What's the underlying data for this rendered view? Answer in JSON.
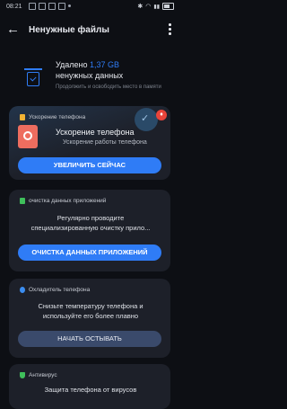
{
  "status": {
    "time": "08:21"
  },
  "appbar": {
    "back_glyph": "←",
    "title": "Ненужные файлы"
  },
  "summary": {
    "prefix": "Удалено",
    "amount": "1,37 GB",
    "line2": "ненужных данных",
    "hint": "Продолжить и освободить место в памяти"
  },
  "cards": {
    "boost": {
      "header": "Ускорение телефона",
      "title": "Ускорение телефона",
      "subtitle": "Ускорение работы телефона",
      "button": "УВЕЛИЧИТЬ СЕЙЧАС"
    },
    "apps": {
      "header": "очистка данных приложений",
      "text": "Регулярно проводите специализированную очистку прило...",
      "button": "ОЧИСТКА ДАННЫХ ПРИЛОЖЕНИЙ"
    },
    "cool": {
      "header": "Охладитель телефона",
      "text": "Снизьте температуру телефона и используйте его более плавно",
      "button": "НАЧАТЬ ОСТЫВАТЬ"
    },
    "antivirus": {
      "header": "Антивирус",
      "text": "Защита телефона от вирусов"
    }
  },
  "colors": {
    "accent": "#2f7cf6",
    "card": "#1d2029",
    "background": "#0d0f14"
  }
}
